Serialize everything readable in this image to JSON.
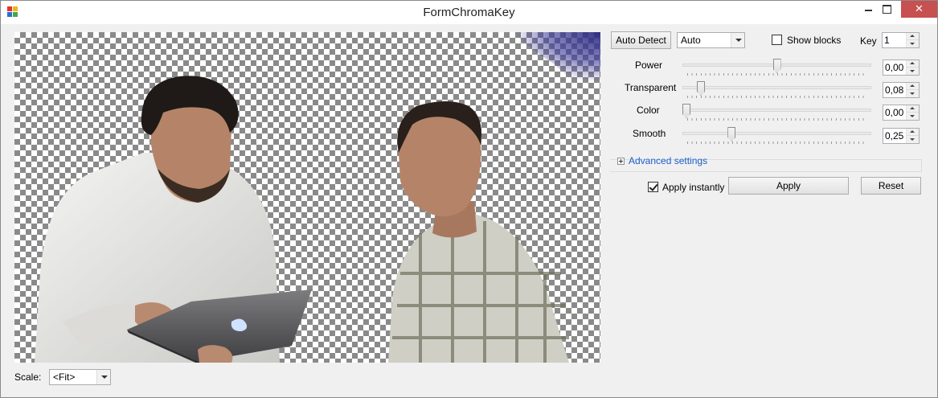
{
  "window": {
    "title": "FormChromaKey",
    "close_glyph": "✕"
  },
  "toolbar": {
    "auto_detect_label": "Auto Detect",
    "mode_value": "Auto",
    "show_blocks_label": "Show blocks",
    "show_blocks_checked": false,
    "key_label": "Key",
    "key_value": "1"
  },
  "sliders": [
    {
      "label": "Power",
      "value": "0,00",
      "level": 0.5
    },
    {
      "label": "Transparent",
      "value": "0,08",
      "level": 0.08
    },
    {
      "label": "Color",
      "value": "0,00",
      "level": 0.0
    },
    {
      "label": "Smooth",
      "value": "0,25",
      "level": 0.25
    }
  ],
  "advanced": {
    "label": "Advanced settings",
    "expanded": false
  },
  "actions": {
    "apply_instantly_label": "Apply instantly",
    "apply_instantly_checked": true,
    "apply_label": "Apply",
    "reset_label": "Reset"
  },
  "footer": {
    "scale_label": "Scale:",
    "scale_value": "<Fit>"
  },
  "icons": {
    "app": "app-icon",
    "minimize": "minimize-icon",
    "maximize": "maximize-icon",
    "close": "close-icon"
  },
  "colors": {
    "app_icon_red": "#e0362c",
    "app_icon_yellow": "#f1b51c",
    "app_icon_blue": "#2a6fd1",
    "app_icon_green": "#47a84a",
    "close_bg": "#c75050",
    "link": "#1a5fc8"
  }
}
